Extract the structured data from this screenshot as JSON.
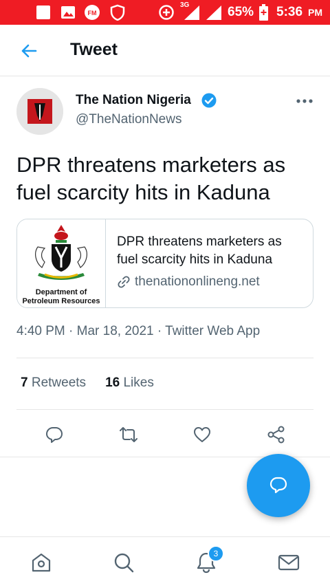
{
  "status_bar": {
    "network": "3G",
    "battery": "65%",
    "time": "5:36",
    "ampm": "PM",
    "icons": [
      "image-icon",
      "gallery-icon",
      "fm-icon",
      "shield-icon",
      "data-saver-icon",
      "signal-icon",
      "signal-icon",
      "battery-charging-icon"
    ]
  },
  "header": {
    "title": "Tweet",
    "back_icon": "arrow-left-icon"
  },
  "tweet": {
    "author_name": "The Nation Nigeria",
    "author_handle": "@TheNationNews",
    "text": "DPR threatens marketers as fuel scarcity hits in Kaduna",
    "card": {
      "title": "DPR threatens marketers as fuel scarcity hits in Kaduna",
      "domain": "thenationonlineng.net",
      "image_caption_1": "Department of",
      "image_caption_2": "Petroleum Resources"
    },
    "meta": "4:40 PM · Mar 18, 2021 · Twitter Web App",
    "retweets_count": "7",
    "retweets_label": "Retweets",
    "likes_count": "16",
    "likes_label": "Likes"
  },
  "bottom_nav": {
    "notifications_badge": "3"
  },
  "colors": {
    "status_bar": "#ef1c24",
    "twitter_blue": "#1d9bf0",
    "muted": "#536471"
  }
}
